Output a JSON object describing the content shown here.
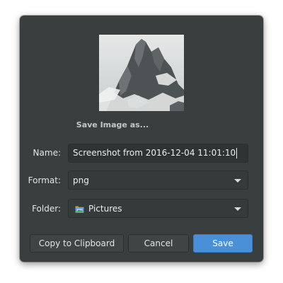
{
  "dialog": {
    "title": "Save Image as..."
  },
  "form": {
    "name_label": "Name:",
    "name_value": "Screenshot from 2016-12-04 11:01:10",
    "format_label": "Format:",
    "format_value": "png",
    "folder_label": "Folder:",
    "folder_value": "Pictures"
  },
  "buttons": {
    "copy": "Copy to Clipboard",
    "cancel": "Cancel",
    "save": "Save"
  },
  "icons": {
    "folder": "pictures-folder-icon",
    "dropdown": "chevron-down-icon"
  },
  "colors": {
    "dialog_bg": "#393f3f",
    "accent": "#4a90d9"
  }
}
